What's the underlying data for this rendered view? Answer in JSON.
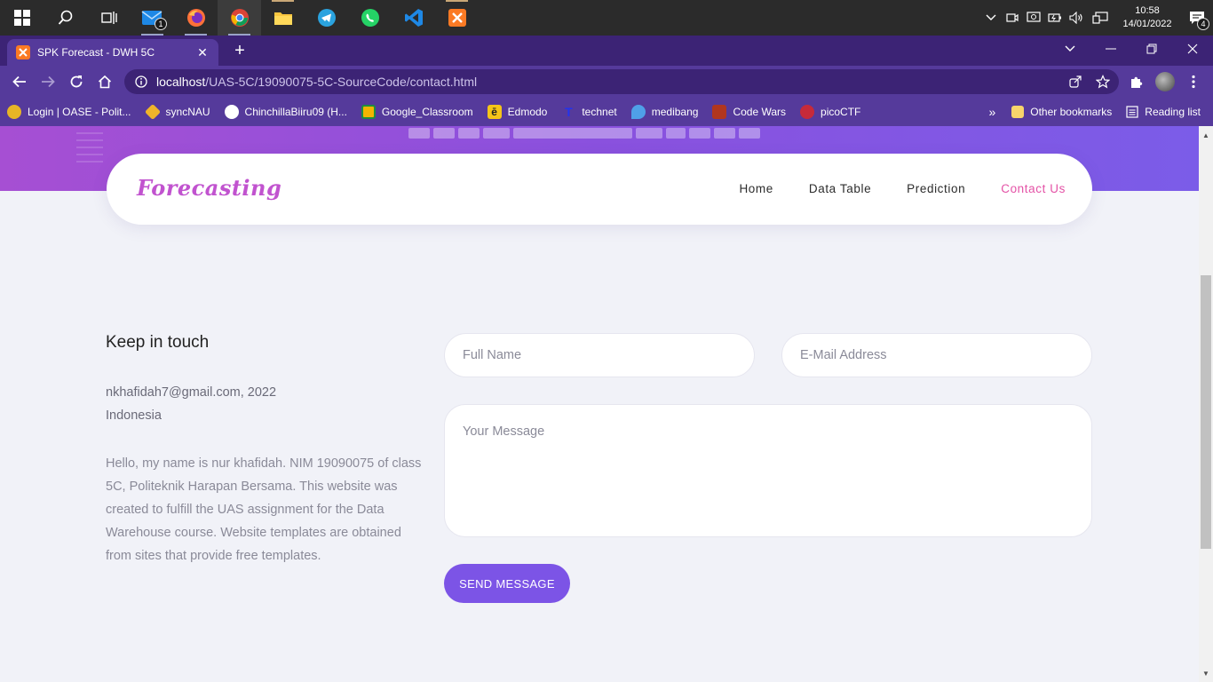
{
  "taskbar": {
    "time": "10:58",
    "date": "14/01/2022",
    "mail_badge": "1",
    "notification_count": "4"
  },
  "browser": {
    "tab_title": "SPK Forecast - DWH 5C",
    "url_host": "localhost",
    "url_path": "/UAS-5C/19090075-5C-SourceCode/contact.html",
    "bookmarks": [
      {
        "label": "Login | OASE - Polit..."
      },
      {
        "label": "syncNAU"
      },
      {
        "label": "ChinchillaBiiru09 (H..."
      },
      {
        "label": "Google_Classroom"
      },
      {
        "label": "Edmodo"
      },
      {
        "label": "technet"
      },
      {
        "label": "medibang"
      },
      {
        "label": "Code Wars"
      },
      {
        "label": "picoCTF"
      }
    ],
    "more_bookmarks": "»",
    "other_bookmarks": "Other bookmarks",
    "reading_list": "Reading list"
  },
  "site": {
    "logo": "Forecasting",
    "nav": [
      {
        "label": "Home"
      },
      {
        "label": "Data Table"
      },
      {
        "label": "Prediction"
      },
      {
        "label": "Contact Us"
      }
    ]
  },
  "contact": {
    "title": "Keep in touch",
    "email_line": "nkhafidah7@gmail.com, 2022",
    "country": "Indonesia",
    "about": "Hello, my name is nur khafidah. NIM 19090075 of class 5C, Politeknik Harapan Bersama. This website was created to fulfill the UAS assignment for the Data Warehouse course. Website templates are obtained from sites that provide free templates.",
    "form": {
      "name_placeholder": "Full Name",
      "email_placeholder": "E-Mail Address",
      "message_placeholder": "Your Message",
      "submit_label": "SEND MESSAGE"
    }
  },
  "colors": {
    "accent": "#7c54e6",
    "nav_active": "#e452a6",
    "logo": "#c153cf",
    "browser_frame": "#553a9b"
  }
}
